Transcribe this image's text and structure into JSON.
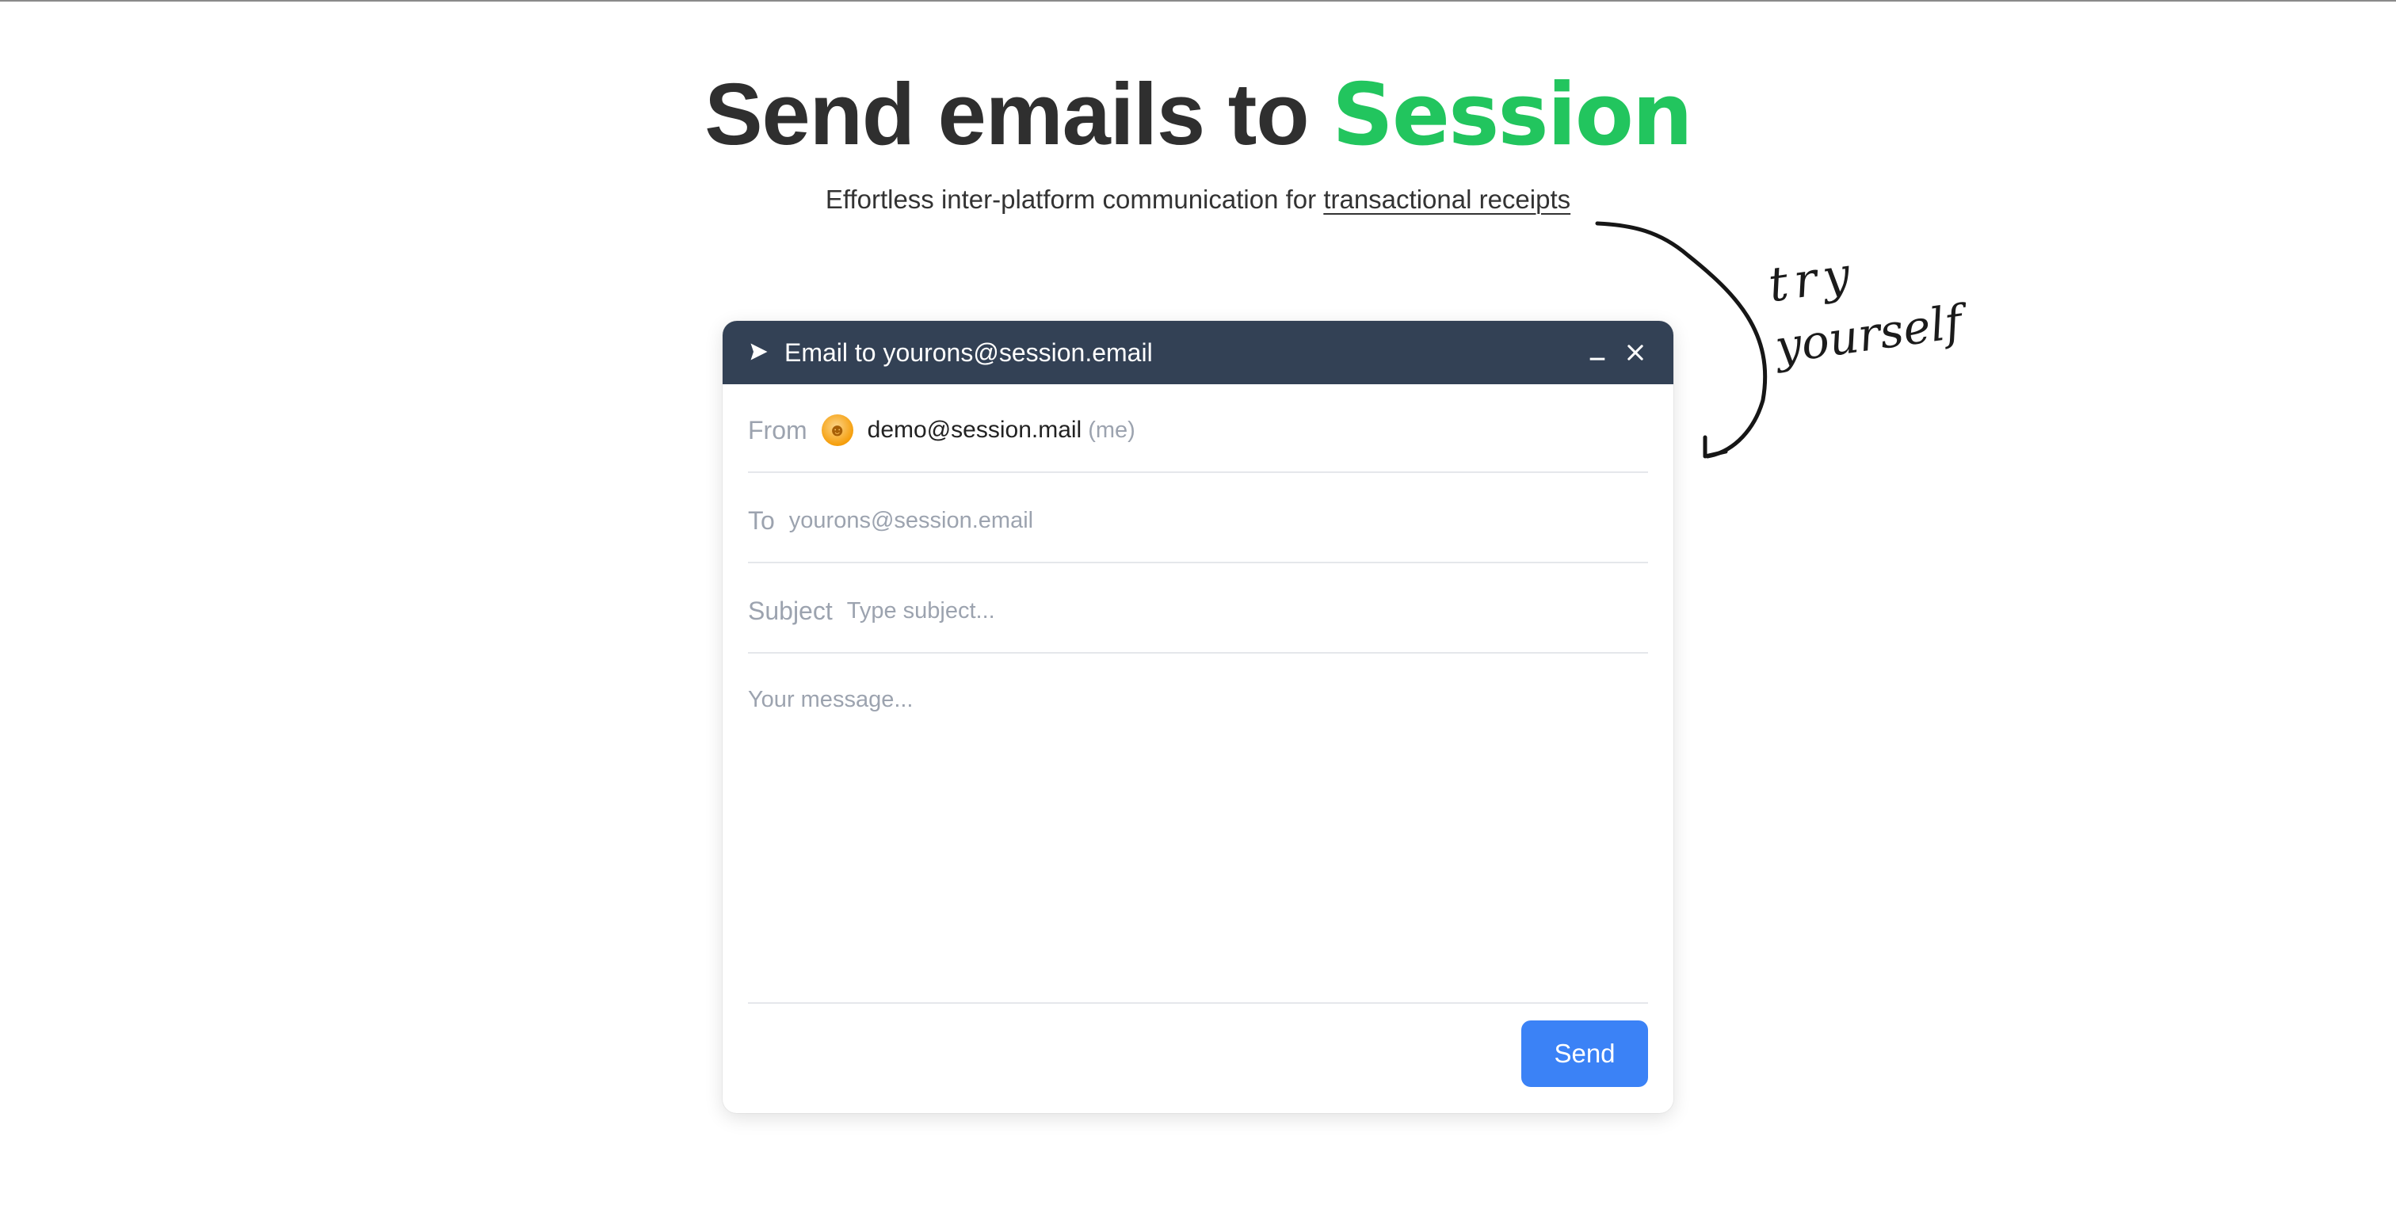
{
  "hero": {
    "headline_prefix": "Send emails to",
    "headline_brand": "Session",
    "subtitle_prefix": "Effortless inter-platform communication for",
    "subtitle_link": "transactional receipts"
  },
  "annotation": {
    "line1": "try",
    "line2": "yourself"
  },
  "compose": {
    "title": "Email to yourons@session.email",
    "from_label": "From",
    "from_email": "demo@session.mail",
    "from_me": "(me)",
    "to_label": "To",
    "to_placeholder": "yourons@session.email",
    "subject_label": "Subject",
    "subject_placeholder": "Type subject...",
    "message_placeholder": "Your message...",
    "send_label": "Send"
  },
  "colors": {
    "brand": "#22c55e",
    "compose_bar": "#334155",
    "send_button": "#3b82f6"
  },
  "icons": {
    "title_icon": "send-icon",
    "minimize": "minimize-icon",
    "close": "close-icon",
    "avatar": "avatar-emoji"
  }
}
